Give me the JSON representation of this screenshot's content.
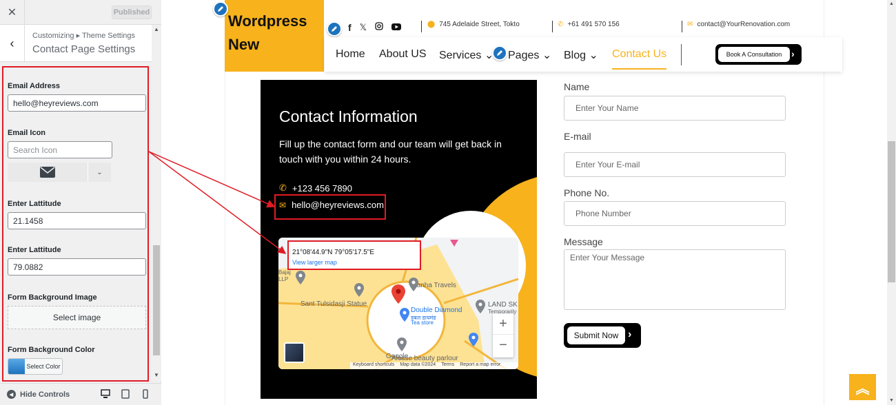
{
  "customizer": {
    "published_label": "Published",
    "breadcrumb": "Customizing ▸ Theme Settings",
    "section_title": "Contact Page Settings",
    "fields": {
      "email_label": "Email Address",
      "email_value": "hello@heyreviews.com",
      "email_icon_label": "Email Icon",
      "search_icon_placeholder": "Search Icon",
      "lat1_label": "Enter Lattitude",
      "lat1_value": "21.1458",
      "lat2_label": "Enter Lattitude",
      "lat2_value": "79.0882",
      "bg_image_label": "Form Background Image",
      "select_image_label": "Select image",
      "bg_color_label": "Form Background Color",
      "select_color_label": "Select Color"
    },
    "hide_controls_label": "Hide Controls"
  },
  "site": {
    "logo_line1": "Wordpress",
    "logo_line2": "New",
    "address": "745 Adelaide Street, Tokto",
    "phone": "+61 491 570 156",
    "email": "contact@YourRenovation.com",
    "nav": {
      "home": "Home",
      "about": "About US",
      "services": "Services",
      "pages": "Pages",
      "blog": "Blog",
      "contact": "Contact Us",
      "consult": "Book A Consultation"
    },
    "info": {
      "title": "Contact Information",
      "desc": "Fill up the contact form and our team will get back in touch with you within 24 hours.",
      "phone": "+123 456 7890",
      "email": "hello@heyreviews.com"
    },
    "map": {
      "coords": "21°08'44.9\"N 79°05'17.5\"E",
      "larger_link": "View larger map",
      "labels": {
        "kanha": "Kanha Travels",
        "sant": "Sant Tulsidasji Statue",
        "dd1": "Double Diamond",
        "dd2": "डबल डायमंड",
        "dd3": "Tea store",
        "land": "LAND SK",
        "land2": "Temporarily",
        "beauty": "Alesse beauty parlour",
        "google": "Google",
        "left1": "Bajaj",
        "left2": "LLP"
      },
      "footer": {
        "keyboard": "Keyboard shortcuts",
        "mapdata": "Map data ©2024",
        "terms": "Terms",
        "report": "Report a map error"
      }
    },
    "form": {
      "name_label": "Name",
      "name_ph": "Enter Your Name",
      "email_label": "E-mail",
      "email_ph": "Enter Your E-mail",
      "phone_label": "Phone No.",
      "phone_ph": "Phone Number",
      "message_label": "Message",
      "message_ph": "Enter Your Message",
      "submit": "Submit Now"
    }
  },
  "colors": {
    "accent": "#f7b21c",
    "highlight": "#e01b24"
  }
}
